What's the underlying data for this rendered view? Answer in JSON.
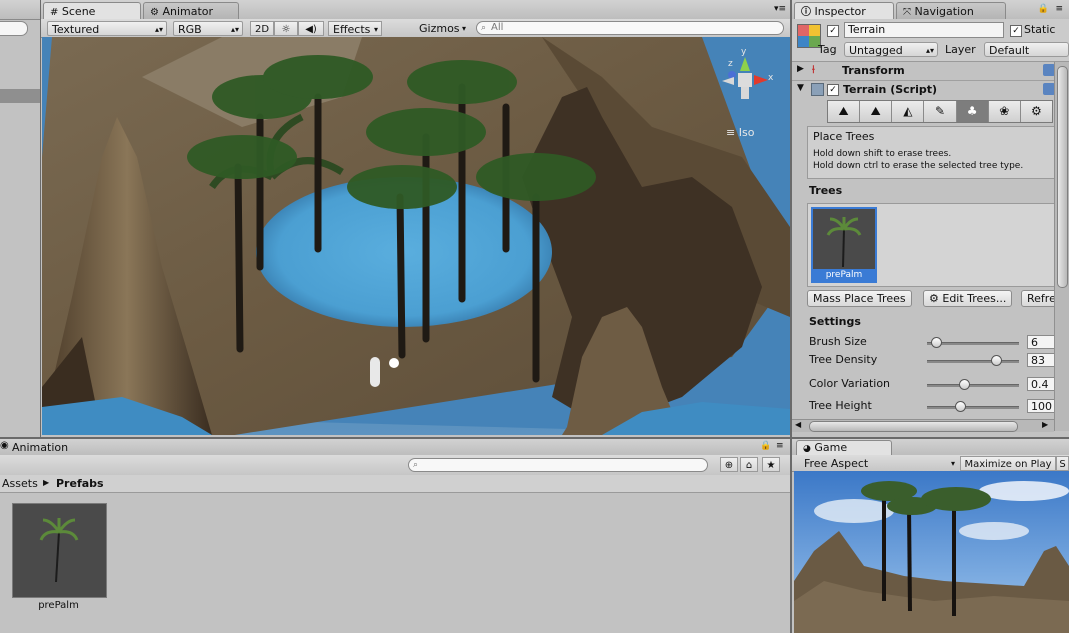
{
  "hierarchy_panel": {
    "corner_tab": ""
  },
  "scene": {
    "tabs": [
      "Scene",
      "Animator"
    ],
    "toolbar": {
      "shading": "Textured",
      "render_mode": "RGB",
      "mode_2d": "2D",
      "effects": "Effects",
      "gizmos": "Gizmos",
      "search_placeholder": "All"
    },
    "gizmo": {
      "x": "x",
      "y": "y",
      "z": "z",
      "projection": "Iso"
    }
  },
  "inspector": {
    "tabs": [
      "Inspector",
      "Navigation"
    ],
    "object_name": "Terrain",
    "static_label": "Static",
    "tag_label": "Tag",
    "tag_value": "Untagged",
    "layer_label": "Layer",
    "layer_value": "Default",
    "components": [
      "Transform",
      "Terrain (Script)"
    ],
    "tool_title": "Place Trees",
    "tool_help": [
      "Hold down shift to erase trees.",
      "Hold down ctrl to erase the selected tree type."
    ],
    "trees_header": "Trees",
    "tree_items": [
      {
        "name": "prePalm"
      }
    ],
    "buttons": {
      "mass_place": "Mass Place Trees",
      "edit_trees": "Edit Trees...",
      "refresh": "Refre"
    },
    "settings_header": "Settings",
    "settings": [
      {
        "label": "Brush Size",
        "value": "6",
        "level": 0.05
      },
      {
        "label": "Tree Density",
        "value": "83",
        "level": 0.8
      },
      {
        "label": "Color Variation",
        "value": "0.4",
        "level": 0.4
      },
      {
        "label": "Tree Height",
        "value": "100",
        "level": 0.35
      }
    ]
  },
  "animation": {
    "tab": "Animation",
    "breadcrumb": [
      "Assets",
      "Prefabs"
    ],
    "assets": [
      {
        "name": "prePalm"
      }
    ]
  },
  "game": {
    "tab": "Game",
    "aspect": "Free Aspect",
    "maximize": "Maximize on Play",
    "stats_short": "S"
  }
}
